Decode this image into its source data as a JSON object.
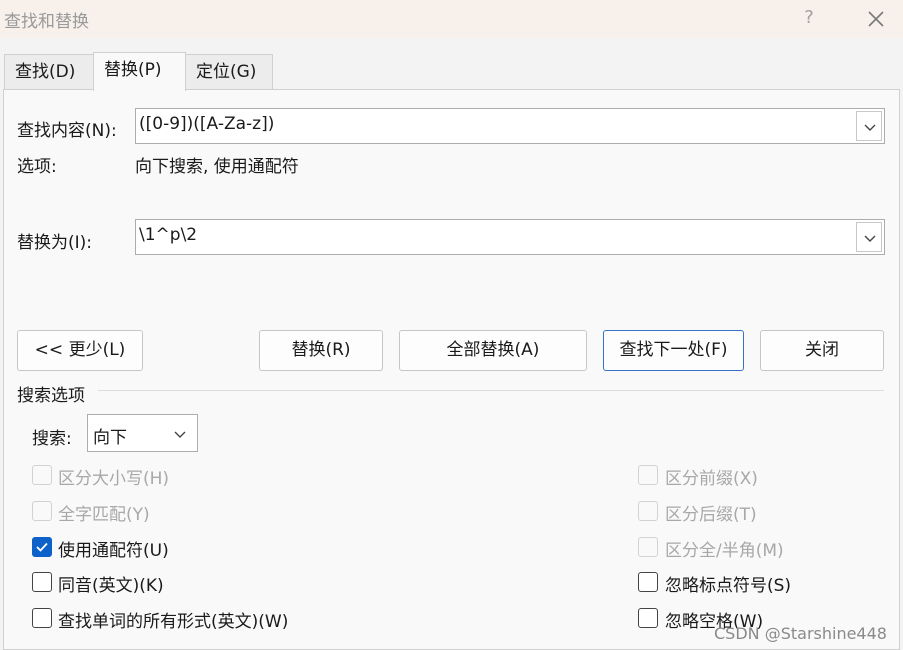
{
  "window": {
    "title": "查找和替换",
    "help_label": "?",
    "close_icon": "close-icon"
  },
  "tabs": [
    {
      "label": "查找(D)",
      "active": false
    },
    {
      "label": "替换(P)",
      "active": true
    },
    {
      "label": "定位(G)",
      "active": false
    }
  ],
  "find": {
    "label": "查找内容(N):",
    "value": "([0-9])([A-Za-z])"
  },
  "options": {
    "label": "选项:",
    "value": "向下搜索, 使用通配符"
  },
  "replace": {
    "label": "替换为(I):",
    "value": "\\1^p\\2"
  },
  "buttons": {
    "less": "<< 更少(L)",
    "replace": "替换(R)",
    "replace_all": "全部替换(A)",
    "find_next": "查找下一处(F)",
    "close": "关闭"
  },
  "search_options": {
    "group_label": "搜索选项",
    "direction_label": "搜索:",
    "direction_value": "向下"
  },
  "checkboxes_left": [
    {
      "label": "区分大小写(H)",
      "checked": false,
      "disabled": true
    },
    {
      "label": "全字匹配(Y)",
      "checked": false,
      "disabled": true
    },
    {
      "label": "使用通配符(U)",
      "checked": true,
      "disabled": false
    },
    {
      "label": "同音(英文)(K)",
      "checked": false,
      "disabled": false
    },
    {
      "label": "查找单词的所有形式(英文)(W)",
      "checked": false,
      "disabled": false
    }
  ],
  "checkboxes_right": [
    {
      "label": "区分前缀(X)",
      "checked": false,
      "disabled": true
    },
    {
      "label": "区分后缀(T)",
      "checked": false,
      "disabled": true
    },
    {
      "label": "区分全/半角(M)",
      "checked": false,
      "disabled": true
    },
    {
      "label": "忽略标点符号(S)",
      "checked": false,
      "disabled": false
    },
    {
      "label": "忽略空格(W)",
      "checked": false,
      "disabled": false
    }
  ],
  "watermark": "CSDN @Starshine448",
  "colors": {
    "accent": "#0d62c9",
    "default_button_border": "#3872c4",
    "disabled_text": "#a8a8a8"
  }
}
